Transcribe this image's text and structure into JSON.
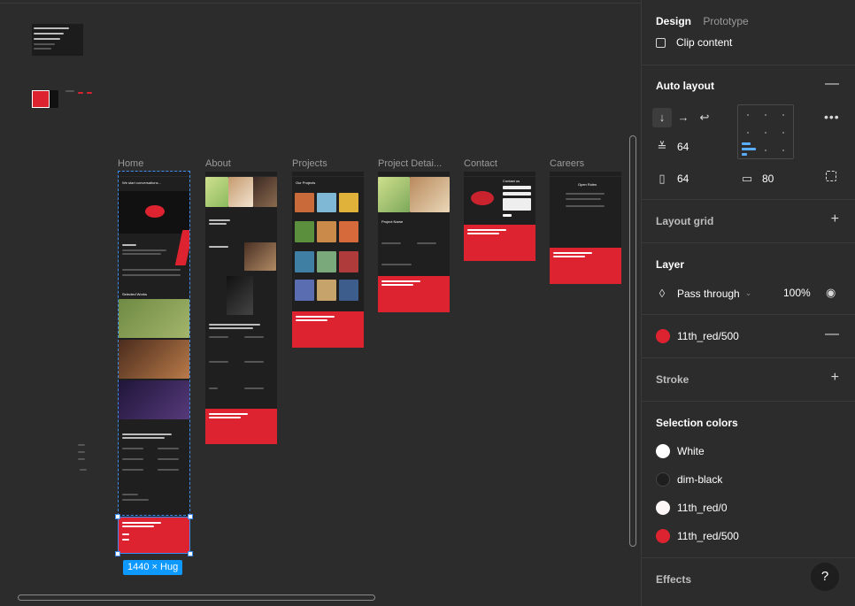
{
  "canvas": {
    "frames": [
      {
        "id": "home",
        "label": "Home"
      },
      {
        "id": "about",
        "label": "About"
      },
      {
        "id": "projects",
        "label": "Projects"
      },
      {
        "id": "project-details",
        "label": "Project Detai..."
      },
      {
        "id": "contact",
        "label": "Contact"
      },
      {
        "id": "careers",
        "label": "Careers"
      }
    ],
    "selection_size": "1440 × Hug",
    "home_hero_text": "We start conversations...",
    "selected_works": "Selected Works",
    "projects_title": "Our Projects",
    "project_name": "Project Name",
    "contact_title": "Contact us",
    "careers_title": "Open Roles",
    "footer_cta": "Start your project with eleventh space now. Let's work together."
  },
  "panel": {
    "tabs": [
      {
        "label": "Design",
        "active": true
      },
      {
        "label": "Prototype",
        "active": false
      }
    ],
    "clip_content": "Clip content",
    "auto_layout": {
      "title": "Auto layout",
      "gap": "64",
      "padding_h": "64",
      "padding_v": "80"
    },
    "layout_grid": "Layout grid",
    "layer": {
      "title": "Layer",
      "blend": "Pass through",
      "opacity": "100%"
    },
    "fill": {
      "name": "11th_red/500",
      "color": "#dd2330"
    },
    "stroke": "Stroke",
    "selection_colors": {
      "title": "Selection colors",
      "items": [
        {
          "name": "White",
          "color": "#ffffff"
        },
        {
          "name": "dim-black",
          "color": "#1e1e1e"
        },
        {
          "name": "11th_red/0",
          "color": "#fdf6f6"
        },
        {
          "name": "11th_red/500",
          "color": "#dd2330"
        }
      ]
    },
    "effects": "Effects",
    "help": "?"
  }
}
